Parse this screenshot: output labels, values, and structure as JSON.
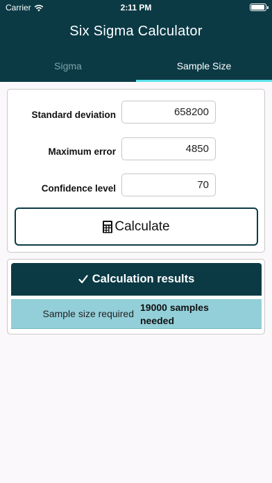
{
  "status_bar": {
    "carrier": "Carrier",
    "time": "2:11 PM"
  },
  "header": {
    "title": "Six Sigma Calculator"
  },
  "tabs": [
    {
      "label": "Sigma",
      "active": false
    },
    {
      "label": "Sample Size",
      "active": true
    }
  ],
  "form": {
    "fields": [
      {
        "label": "Standard deviation",
        "value": "658200"
      },
      {
        "label": "Maximum error",
        "value": "4850"
      },
      {
        "label": "Confidence level",
        "value": "70"
      }
    ],
    "calculate_label": "Calculate"
  },
  "results": {
    "header": "Calculation results",
    "rows": [
      {
        "label": "Sample size required",
        "value": "19000 samples needed"
      }
    ]
  },
  "icons": [
    "wifi-icon",
    "battery-icon",
    "calculator-icon",
    "checkmark-icon"
  ],
  "colors": {
    "header_bg": "#0b3a45",
    "tab_indicator": "#5ee3ec",
    "result_row_bg": "#93cfd9",
    "page_bg": "#fbf8fb"
  }
}
